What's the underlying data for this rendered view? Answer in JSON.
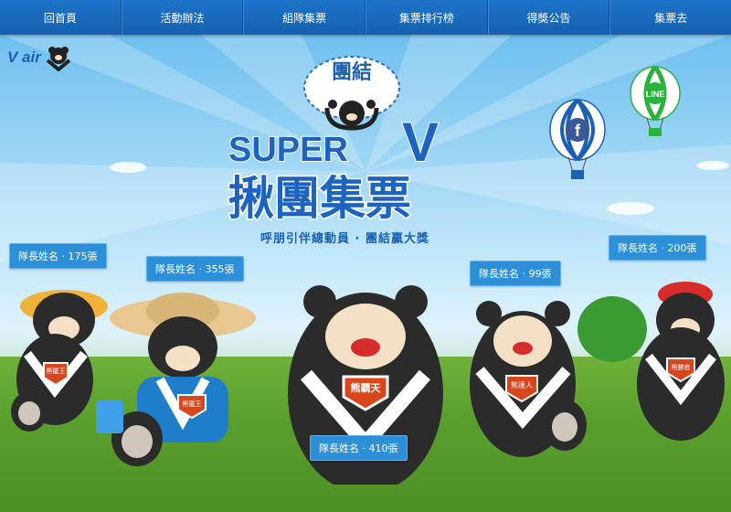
{
  "nav": {
    "items": [
      "回首頁",
      "活動辦法",
      "組隊集票",
      "集票排行榜",
      "得獎公告",
      "集票去"
    ]
  },
  "logo": {
    "text": "V air",
    "icon": "bear-icon"
  },
  "title": {
    "badge": "團結",
    "main": "SUPER",
    "v": "V",
    "sub": "揪團集票"
  },
  "slogan": "呼朋引伴總動員 · 團結贏大獎",
  "balloons": [
    {
      "label": "f",
      "icon": "facebook-icon"
    },
    {
      "label": "LINE",
      "icon": "line-icon"
    }
  ],
  "tags": [
    {
      "text": "隊長姓名 · 175張"
    },
    {
      "text": "隊長姓名 · 355張"
    },
    {
      "text": "隊長姓名 · 410張"
    },
    {
      "text": "隊長姓名 · 99張"
    },
    {
      "text": "隊長姓名 · 200張"
    }
  ],
  "bears": [
    {
      "badge": "熊龍王"
    },
    {
      "badge": "熊覇天"
    },
    {
      "badge": "熊達人"
    },
    {
      "badge": "熊勝者"
    }
  ],
  "colors": {
    "nav": "#1d74c9",
    "accent": "#1b62b5",
    "tag": "#2c8fd8",
    "badge": "#d9461c"
  }
}
